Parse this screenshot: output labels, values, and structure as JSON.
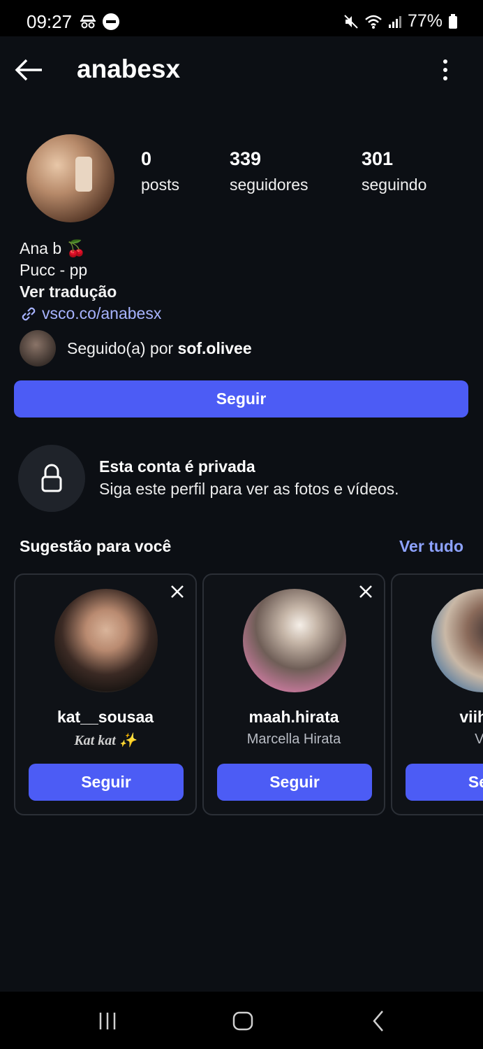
{
  "status_bar": {
    "time": "09:27",
    "battery": "77%",
    "icons": [
      "incognito-icon",
      "do-not-disturb-icon",
      "mute-icon",
      "wifi-icon",
      "signal-icon",
      "battery-icon"
    ]
  },
  "header": {
    "username": "anabesx",
    "back_icon": "back-arrow-icon",
    "more_icon": "more-vertical-icon"
  },
  "profile": {
    "stats": [
      {
        "value": "0",
        "label": "posts"
      },
      {
        "value": "339",
        "label": "seguidores"
      },
      {
        "value": "301",
        "label": "seguindo"
      }
    ],
    "name": "Ana b 🍒",
    "bio_line": "Pucc - pp",
    "translate_label": "Ver tradução",
    "link": "vsco.co/anabesx",
    "followed_by_prefix": "Seguido(a) por ",
    "followed_by_user": "sof.olivee",
    "follow_button": "Seguir"
  },
  "private_notice": {
    "title": "Esta conta é privada",
    "subtitle": "Siga este perfil para ver as fotos e vídeos."
  },
  "suggestions": {
    "heading": "Sugestão para você",
    "see_all": "Ver tudo",
    "items": [
      {
        "username": "kat__sousaa",
        "subtitle": "Kat kat ✨",
        "button": "Seguir"
      },
      {
        "username": "maah.hirata",
        "subtitle": "Marcella Hirata",
        "button": "Seguir"
      },
      {
        "username": "viih_k",
        "subtitle": "Vii",
        "button": "Seg"
      }
    ]
  },
  "theme": {
    "background": "#0c0f14",
    "accent": "#4c5cf5",
    "link": "#a7b3ff"
  }
}
